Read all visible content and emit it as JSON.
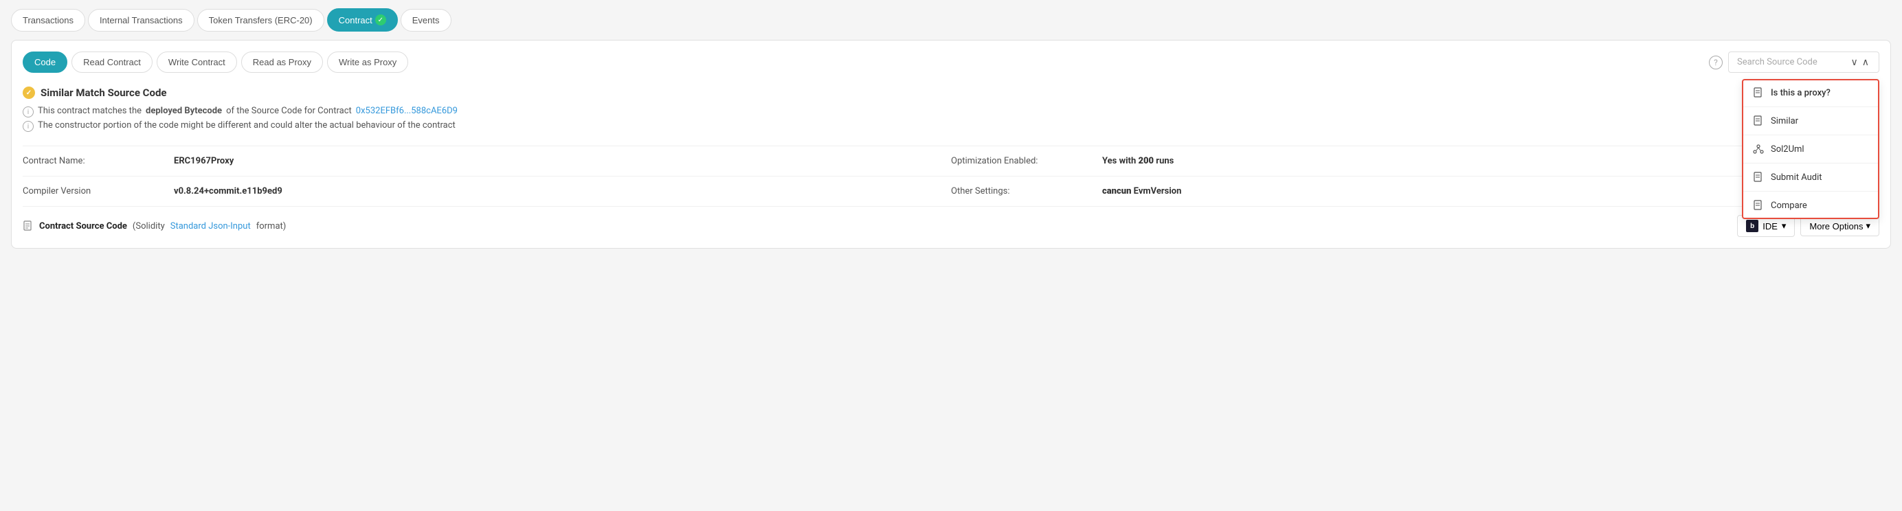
{
  "topTabs": {
    "items": [
      {
        "id": "transactions",
        "label": "Transactions",
        "active": false
      },
      {
        "id": "internal-transactions",
        "label": "Internal Transactions",
        "active": false
      },
      {
        "id": "token-transfers",
        "label": "Token Transfers (ERC-20)",
        "active": false
      },
      {
        "id": "contract",
        "label": "Contract",
        "active": true
      },
      {
        "id": "events",
        "label": "Events",
        "active": false
      }
    ]
  },
  "subTabs": {
    "items": [
      {
        "id": "code",
        "label": "Code",
        "active": true
      },
      {
        "id": "read-contract",
        "label": "Read Contract",
        "active": false
      },
      {
        "id": "write-contract",
        "label": "Write Contract",
        "active": false
      },
      {
        "id": "read-as-proxy",
        "label": "Read as Proxy",
        "active": false
      },
      {
        "id": "write-as-proxy",
        "label": "Write as Proxy",
        "active": false
      }
    ]
  },
  "search": {
    "placeholder": "Search Source Code"
  },
  "similarMatch": {
    "title": "Similar Match Source Code",
    "info1_prefix": "This contract matches the ",
    "info1_bold": "deployed Bytecode",
    "info1_suffix": " of the Source Code for Contract ",
    "info1_link": "0x532EFBf6...588cAE6D9",
    "info2": "The constructor portion of the code might be different and could alter the actual behaviour of the contract"
  },
  "contractDetails": {
    "name_label": "Contract Name:",
    "name_value": "ERC1967Proxy",
    "optimization_label": "Optimization Enabled:",
    "optimization_value": "Yes with ",
    "optimization_runs": "200",
    "optimization_suffix": " runs",
    "compiler_label": "Compiler Version",
    "compiler_value": "v0.8.24+commit.e11b9ed9",
    "settings_label": "Other Settings:",
    "settings_value_bold": "cancun",
    "settings_value_suffix": " EvmVersion"
  },
  "sourceCodeSection": {
    "icon": "📄",
    "label": "Contract Source Code",
    "paren_prefix": "(Solidity ",
    "link_text": "Standard Json-Input",
    "paren_suffix": " format)"
  },
  "dropdown": {
    "items": [
      {
        "id": "is-proxy",
        "label": "Is this a proxy?",
        "icon": "doc"
      },
      {
        "id": "similar",
        "label": "Similar",
        "icon": "doc"
      },
      {
        "id": "sol2uml",
        "label": "Sol2Uml",
        "icon": "tree"
      },
      {
        "id": "submit-audit",
        "label": "Submit Audit",
        "icon": "doc"
      },
      {
        "id": "compare",
        "label": "Compare",
        "icon": "doc"
      }
    ]
  },
  "buttons": {
    "ide_label": "IDE",
    "more_options_label": "More Options"
  }
}
